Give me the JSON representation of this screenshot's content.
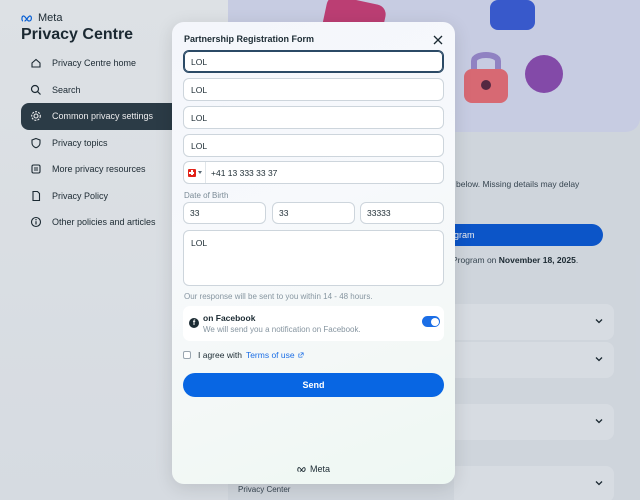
{
  "site": {
    "brand": "Meta",
    "title": "Privacy Centre"
  },
  "nav": {
    "items": [
      {
        "label": "Privacy Centre home",
        "icon": "home-icon"
      },
      {
        "label": "Search",
        "icon": "search-icon"
      },
      {
        "label": "Common privacy settings",
        "icon": "gear-icon",
        "active": true
      },
      {
        "label": "Privacy topics",
        "icon": "shield-icon"
      },
      {
        "label": "More privacy resources",
        "icon": "resources-icon"
      },
      {
        "label": "Privacy Policy",
        "icon": "document-icon"
      },
      {
        "label": "Other policies and articles",
        "icon": "info-icon"
      }
    ]
  },
  "background": {
    "info_text": "below. Missing details may delay",
    "cta_label": "gram",
    "program_text_prefix": "Program on",
    "program_date": "November 18, 2025",
    "footer_text": "Privacy Center"
  },
  "modal": {
    "title": "Partnership Registration Form",
    "fields": {
      "field1": "LOL",
      "field2": "LOL",
      "field3": "LOL",
      "field4": "LOL"
    },
    "phone": {
      "country": "Switzerland",
      "value": "+41 13 333 33 37"
    },
    "dob": {
      "label": "Date of Birth",
      "day": "33",
      "month": "33",
      "year": "33333"
    },
    "message": "LOL",
    "response_note": "Our response will be sent to you within 14 - 48 hours.",
    "notification": {
      "title": "on Facebook",
      "subtitle": "We will send you a notification on Facebook.",
      "enabled": true
    },
    "agree": {
      "prefix": "I agree with",
      "link": "Terms of use",
      "checked": false
    },
    "send_label": "Send",
    "footer_logo": "Meta"
  },
  "colors": {
    "accent": "#0866e3",
    "nav_active": "#2d3e49",
    "toggle_on": "#1b6ee6"
  }
}
